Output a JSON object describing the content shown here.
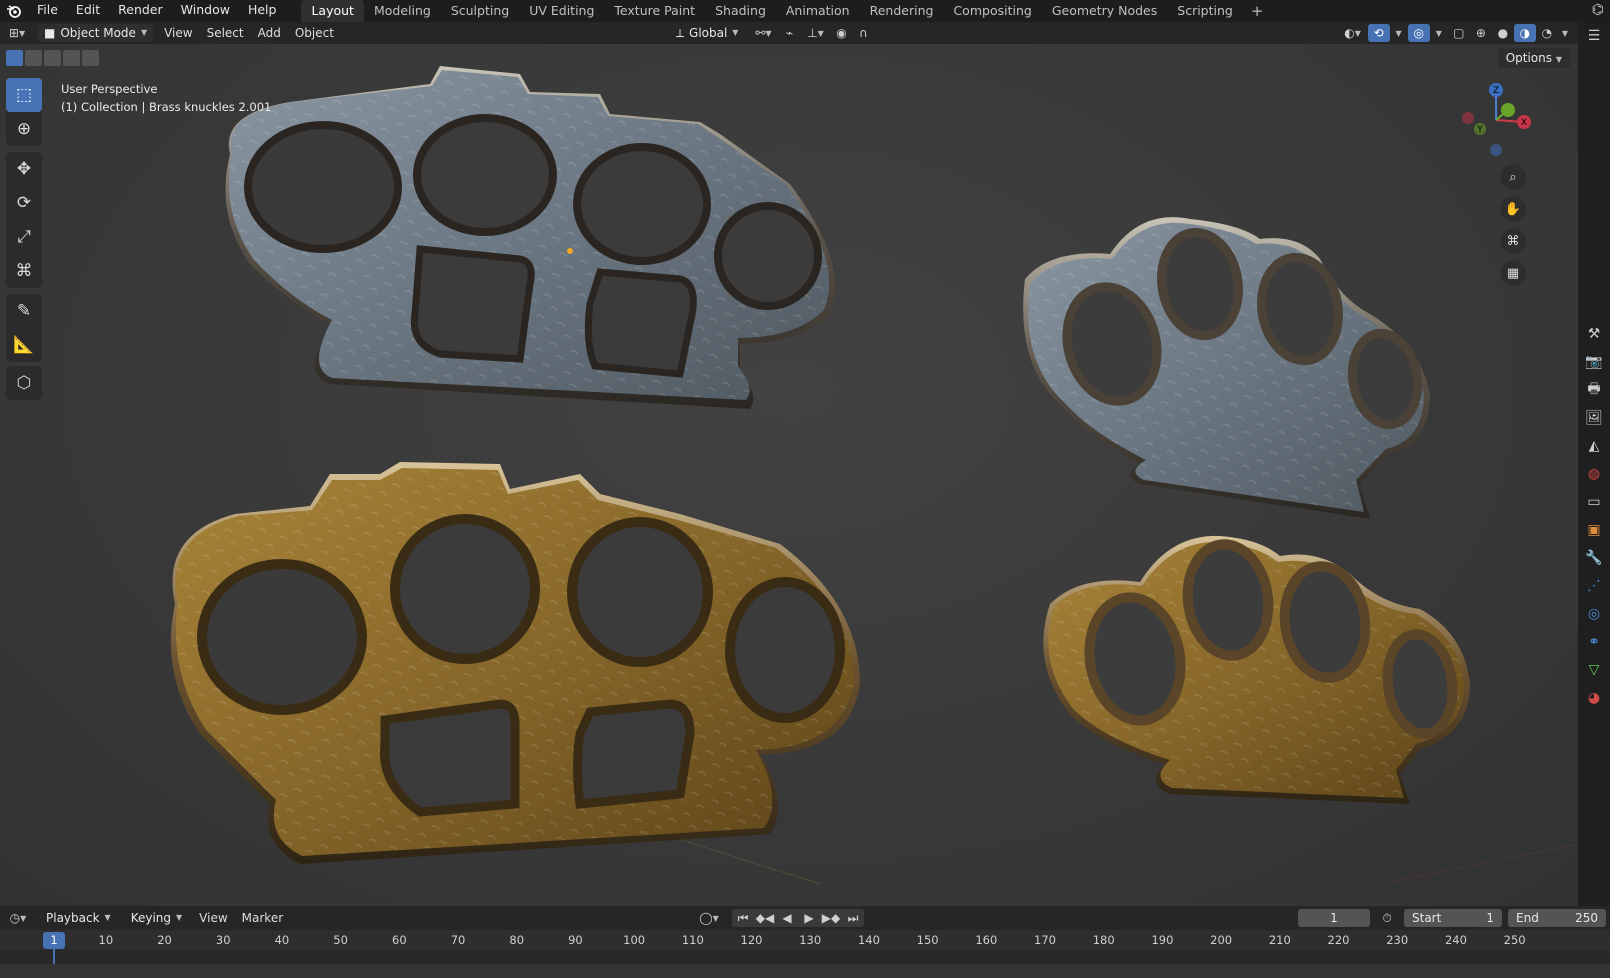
{
  "menu": [
    "File",
    "Edit",
    "Render",
    "Window",
    "Help"
  ],
  "workspaces": [
    "Layout",
    "Modeling",
    "Sculpting",
    "UV Editing",
    "Texture Paint",
    "Shading",
    "Animation",
    "Rendering",
    "Compositing",
    "Geometry Nodes",
    "Scripting"
  ],
  "active_workspace": "Layout",
  "header": {
    "mode": "Object Mode",
    "view": "View",
    "select": "Select",
    "add": "Add",
    "object": "Object",
    "transform_orientation": "Global",
    "options": "Options"
  },
  "viewport": {
    "perspective": "User Perspective",
    "collection_info": "(1) Collection | Brass knuckles 2.001"
  },
  "gizmo": {
    "x": "X",
    "y": "Y",
    "z": "Z"
  },
  "timeline": {
    "playback": "Playback",
    "keying": "Keying",
    "view": "View",
    "marker": "Marker",
    "current_frame": "1",
    "start_label": "Start",
    "start_value": "1",
    "end_label": "End",
    "end_value": "250",
    "ticks": [
      "10",
      "20",
      "30",
      "40",
      "50",
      "60",
      "70",
      "80",
      "90",
      "100",
      "110",
      "120",
      "130",
      "140",
      "150",
      "160",
      "170",
      "180",
      "190",
      "200",
      "210",
      "220",
      "230",
      "240",
      "250"
    ]
  },
  "tools": [
    "select-box-icon",
    "cursor-icon",
    "move-icon",
    "rotate-icon",
    "scale-icon",
    "transform-icon",
    "annotate-icon",
    "measure-icon",
    "add-cube-icon"
  ],
  "colors": {
    "accent": "#4772b3",
    "steel": "#7d8a96",
    "brass": "#8a6a26"
  }
}
